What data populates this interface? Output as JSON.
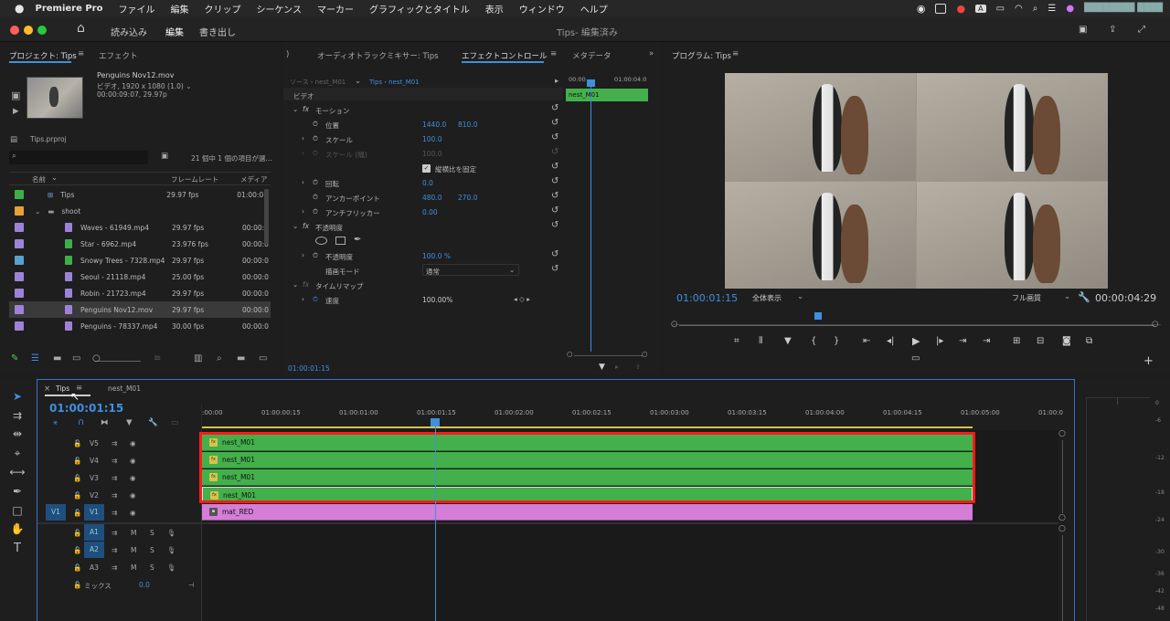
{
  "menubar": {
    "app": "Premiere Pro",
    "items": [
      "ファイル",
      "編集",
      "クリップ",
      "シーケンス",
      "マーカー",
      "グラフィックとタイトル",
      "表示",
      "ウィンドウ",
      "ヘルプ"
    ],
    "user": "████████ ████"
  },
  "titlebar": {
    "home": "⌂",
    "workspaces": [
      "読み込み",
      "編集",
      "書き出し"
    ],
    "active_index": 1,
    "title": "Tips- 編集済み"
  },
  "project": {
    "tab_project": "プロジェクト: Tips",
    "tab_effects": "エフェクト",
    "clip_name": "Penguins Nov12.mov",
    "clip_info": "ビデオ, 1920 x 1080 (1.0) ⌄",
    "clip_dur": "00:00:09:07, 29.97p",
    "file": "Tips.prproj",
    "search_placeholder": "",
    "count": "21 個中 1 個の項目が選...",
    "col_name": "名前",
    "col_fps": "フレームレート",
    "col_media": "メディア",
    "items": [
      {
        "name": "Tips",
        "fps": "29.97 fps",
        "start": "01:00:0",
        "color": "#3fae49",
        "type": "seq"
      },
      {
        "name": "shoot",
        "fps": "",
        "start": "",
        "color": "#e3a137",
        "type": "folder"
      },
      {
        "name": "Waves - 61949.mp4",
        "fps": "29.97 fps",
        "start": "00:00:0",
        "color": "#9d82d8",
        "type": "clip"
      },
      {
        "name": "Star - 6962.mp4",
        "fps": "23.976 fps",
        "start": "00:00:0",
        "color": "#9d82d8",
        "type": "audio"
      },
      {
        "name": "Snowy Trees - 7328.mp4",
        "fps": "29.97 fps",
        "start": "00:00:0",
        "color": "#5aa0d0",
        "type": "audio"
      },
      {
        "name": "Seoul - 21118.mp4",
        "fps": "25.00 fps",
        "start": "00:00:0",
        "color": "#9d82d8",
        "type": "clip"
      },
      {
        "name": "Robin - 21723.mp4",
        "fps": "29.97 fps",
        "start": "00:00:0",
        "color": "#9d82d8",
        "type": "clip"
      },
      {
        "name": "Penguins Nov12.mov",
        "fps": "29.97 fps",
        "start": "00:00:0",
        "color": "#9d82d8",
        "type": "clip"
      },
      {
        "name": "Penguins - 78337.mp4",
        "fps": "30.00 fps",
        "start": "00:00:0",
        "color": "#9d82d8",
        "type": "clip"
      }
    ]
  },
  "effect_controls": {
    "tab_mixer": "オーディオトラックミキサー: Tips",
    "tab_ec": "エフェクトコントロール",
    "tab_meta": "メタデータ",
    "source": "ソース・nest_M01",
    "seq": "Tips・nest_M01",
    "clip_label": "nest_M01",
    "time_start": "00:00",
    "time_end": "01:00:04:0",
    "section_video": "ビデオ",
    "motion": "モーション",
    "position_label": "位置",
    "position_x": "1440.0",
    "position_y": "810.0",
    "scale_label": "スケール",
    "scale_value": "100.0",
    "scale_w_label": "スケール (幅)",
    "scale_w_value": "100.0",
    "uniform_label": "縦横比を固定",
    "rotation_label": "回転",
    "rotation_value": "0.0",
    "anchor_label": "アンカーポイント",
    "anchor_x": "480.0",
    "anchor_y": "270.0",
    "flicker_label": "アンチフリッカー",
    "flicker_value": "0.00",
    "opacity": "不透明度",
    "opacity_label": "不透明度",
    "opacity_value": "100.0 %",
    "blend_label": "描画モード",
    "blend_value": "通常",
    "timeremap": "タイムリマップ",
    "speed_label": "速度",
    "speed_value": "100.00%",
    "current_time": "01:00:01:15"
  },
  "program": {
    "title": "プログラム: Tips",
    "timecode": "01:00:01:15",
    "zoom": "全体表示",
    "quality": "フル画質",
    "duration": "00:00:04:29"
  },
  "timeline": {
    "tab_tips": "Tips",
    "tab_nest": "nest_M01",
    "timecode": "01:00:01:15",
    "ruler": [
      ":00:00",
      "01:00:00:15",
      "01:00:01:00",
      "01:00:01:15",
      "01:00:02:00",
      "01:00:02:15",
      "01:00:03:00",
      "01:00:03:15",
      "01:00:04:00",
      "01:00:04:15",
      "01:00:05:00",
      "01:00:0"
    ],
    "tracks": [
      {
        "name": "V5"
      },
      {
        "name": "V4"
      },
      {
        "name": "V3"
      },
      {
        "name": "V2"
      },
      {
        "name": "V1",
        "src": "V1"
      },
      {
        "name": "A1"
      },
      {
        "name": "A2"
      },
      {
        "name": "A3"
      }
    ],
    "mix_label": "ミックス",
    "mix_value": "0.0",
    "clips": [
      "nest_M01",
      "nest_M01",
      "nest_M01",
      "nest_M01",
      "mat_RED"
    ]
  },
  "meter": {
    "labels": [
      "0",
      "-6",
      "-12",
      "-18",
      "-24",
      "-30",
      "-36",
      "-42",
      "-48"
    ]
  },
  "colors": {
    "accent": "#3f8fe0",
    "clip": "#43b04c",
    "pink": "#d47ed8",
    "highlight": "#ff1a1a"
  }
}
